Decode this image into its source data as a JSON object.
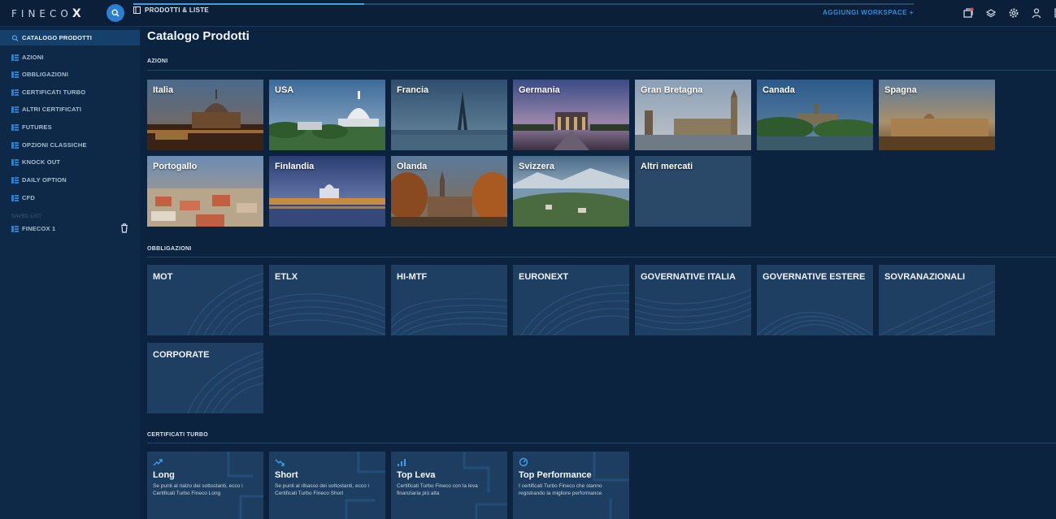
{
  "topbar": {
    "logo_letters": "FINECO",
    "logo_x": "X",
    "workspace_tab": "PRODOTTI & LISTE",
    "add_workspace": "AGGIUNGI WORKSPACE +"
  },
  "sidebar": {
    "items": [
      {
        "label": "CATALOGO PRODOTTI"
      },
      {
        "label": "AZIONI"
      },
      {
        "label": "OBBLIGAZIONI"
      },
      {
        "label": "CERTIFICATI TURBO"
      },
      {
        "label": "ALTRI CERTIFICATI"
      },
      {
        "label": "FUTURES"
      },
      {
        "label": "OPZIONI CLASSICHE"
      },
      {
        "label": "KNOCK OUT"
      },
      {
        "label": "DAILY OPTION"
      },
      {
        "label": "CFD"
      }
    ],
    "saved_label": "SAVED LIST",
    "saved_items": [
      {
        "label": "FINECOX 1"
      }
    ]
  },
  "main": {
    "title": "Catalogo Prodotti",
    "sections": {
      "azioni": "AZIONI",
      "obbligazioni": "OBBLIGAZIONI",
      "certificati": "CERTIFICATI TURBO"
    },
    "azioni_tiles": [
      {
        "name": "Italia"
      },
      {
        "name": "USA"
      },
      {
        "name": "Francia"
      },
      {
        "name": "Germania"
      },
      {
        "name": "Gran Bretagna"
      },
      {
        "name": "Canada"
      },
      {
        "name": "Spagna"
      },
      {
        "name": "Portogallo"
      },
      {
        "name": "Finlandia"
      },
      {
        "name": "Olanda"
      },
      {
        "name": "Svizzera"
      },
      {
        "name": "Altri mercati"
      }
    ],
    "obbligazioni_tiles": [
      {
        "name": "MOT"
      },
      {
        "name": "ETLX"
      },
      {
        "name": "HI-MTF"
      },
      {
        "name": "EURONEXT"
      },
      {
        "name": "GOVERNATIVE ITALIA"
      },
      {
        "name": "GOVERNATIVE ESTERE"
      },
      {
        "name": "SOVRANAZIONALI"
      },
      {
        "name": "CORPORATE"
      }
    ],
    "certificati_tiles": [
      {
        "title": "Long",
        "desc": "Se punti al rialzo dei sottostanti, ecco i Certificati Turbo Fineco Long"
      },
      {
        "title": "Short",
        "desc": "Se punti al ribasso dei sottostanti, ecco i Certificati Turbo Fineco Short"
      },
      {
        "title": "Top Leva",
        "desc": "Certificati Turbo Fineco con la leva finanziaria più alta"
      },
      {
        "title": "Top Performance",
        "desc": "I certificati Turbo Fineco che stanno registrando la migliore performance"
      }
    ]
  },
  "colors": {
    "background": "#0c2340",
    "sidebar": "#0e2948",
    "accent": "#2d8fe0",
    "tile": "#1f3f62"
  }
}
